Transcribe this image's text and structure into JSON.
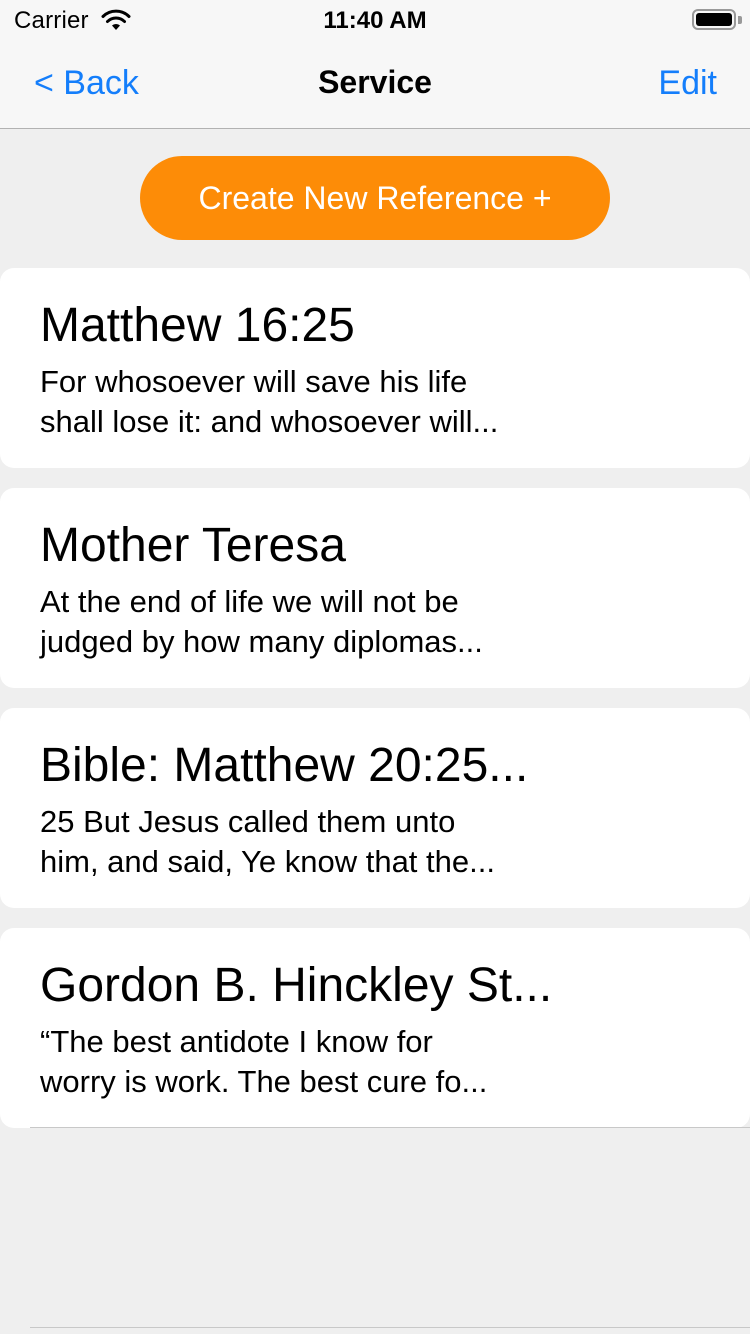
{
  "status_bar": {
    "carrier": "Carrier",
    "time": "11:40 AM",
    "icons": [
      "wifi-icon",
      "battery-icon"
    ]
  },
  "nav": {
    "back_label": "< Back",
    "title": "Service",
    "edit_label": "Edit"
  },
  "create_button_label": "Create New Reference +",
  "references": [
    {
      "title": "Matthew 16:25",
      "excerpt": "For whosoever will save his life\nshall lose it: and whosoever will..."
    },
    {
      "title": "Mother Teresa",
      "excerpt": "At the end of life we will not be\njudged by how many diplomas..."
    },
    {
      "title": "Bible: Matthew 20:25...",
      "excerpt": "25 But Jesus called them unto\nhim, and said, Ye know that the..."
    },
    {
      "title": "Gordon B. Hinckley St...",
      "excerpt": "“The best antidote I know for\nworry is work. The best cure fo..."
    }
  ],
  "colors": {
    "accent_blue": "#147efb",
    "button_orange": "#fd8c07",
    "background": "#efefef",
    "card": "#ffffff"
  }
}
